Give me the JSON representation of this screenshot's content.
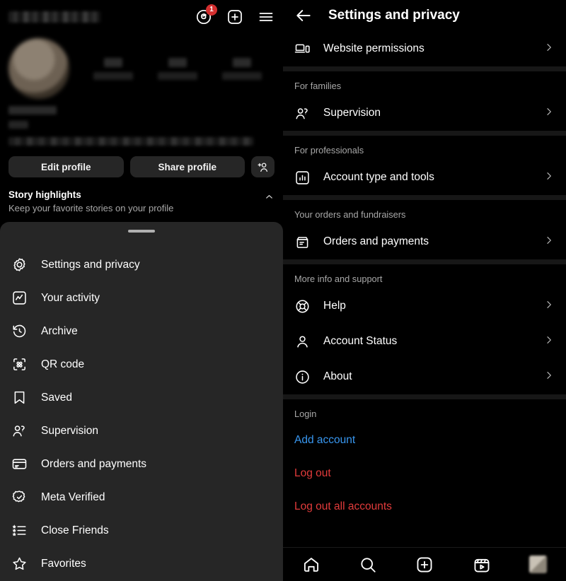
{
  "left_panel": {
    "topbar": {
      "username_redacted": "",
      "icons": [
        {
          "name": "threads-icon",
          "badge": "1"
        },
        {
          "name": "new-post-icon",
          "badge": ""
        },
        {
          "name": "menu-hamburger-icon",
          "badge": ""
        }
      ]
    },
    "profile": {
      "edit_profile_label": "Edit profile",
      "share_profile_label": "Share profile",
      "add_person_icon": "add-person-icon",
      "highlights_title": "Story highlights",
      "highlights_subtitle": "Keep your favorite stories on your profile"
    },
    "sheet_menu": [
      {
        "label": "Settings and privacy",
        "icon": "settings-gear-icon"
      },
      {
        "label": "Your activity",
        "icon": "activity-chart-icon"
      },
      {
        "label": "Archive",
        "icon": "archive-clock-icon"
      },
      {
        "label": "QR code",
        "icon": "qr-code-icon"
      },
      {
        "label": "Saved",
        "icon": "bookmark-icon"
      },
      {
        "label": "Supervision",
        "icon": "supervision-people-icon"
      },
      {
        "label": "Orders and payments",
        "icon": "credit-card-icon"
      },
      {
        "label": "Meta Verified",
        "icon": "verified-badge-icon"
      },
      {
        "label": "Close Friends",
        "icon": "star-list-icon"
      },
      {
        "label": "Favorites",
        "icon": "star-icon"
      }
    ]
  },
  "right_panel": {
    "header": {
      "title": "Settings and privacy",
      "back_icon": "back-arrow-icon"
    },
    "groups": [
      {
        "heading": "",
        "items": [
          {
            "label": "Website permissions",
            "icon": "devices-icon"
          }
        ]
      },
      {
        "heading": "For families",
        "items": [
          {
            "label": "Supervision",
            "icon": "supervision-people-icon"
          }
        ]
      },
      {
        "heading": "For professionals",
        "items": [
          {
            "label": "Account type and tools",
            "icon": "bar-chart-box-icon"
          }
        ]
      },
      {
        "heading": "Your orders and fundraisers",
        "items": [
          {
            "label": "Orders and payments",
            "icon": "receipt-box-icon"
          }
        ]
      },
      {
        "heading": "More info and support",
        "items": [
          {
            "label": "Help",
            "icon": "lifebuoy-icon"
          },
          {
            "label": "Account Status",
            "icon": "person-icon"
          },
          {
            "label": "About",
            "icon": "info-circle-icon"
          }
        ]
      }
    ],
    "login_section": {
      "heading": "Login",
      "add_account": "Add account",
      "log_out": "Log out",
      "log_out_all": "Log out all accounts"
    },
    "bottom_nav": [
      {
        "name": "home-icon"
      },
      {
        "name": "search-icon"
      },
      {
        "name": "create-icon"
      },
      {
        "name": "reels-icon"
      },
      {
        "name": "profile-avatar"
      }
    ]
  },
  "colors": {
    "background": "#000000",
    "sheet": "#262626",
    "link_blue": "#3897F0",
    "danger_red": "#E23B3B",
    "muted_text": "#A8A8A8",
    "badge_red": "#D32F2F"
  }
}
